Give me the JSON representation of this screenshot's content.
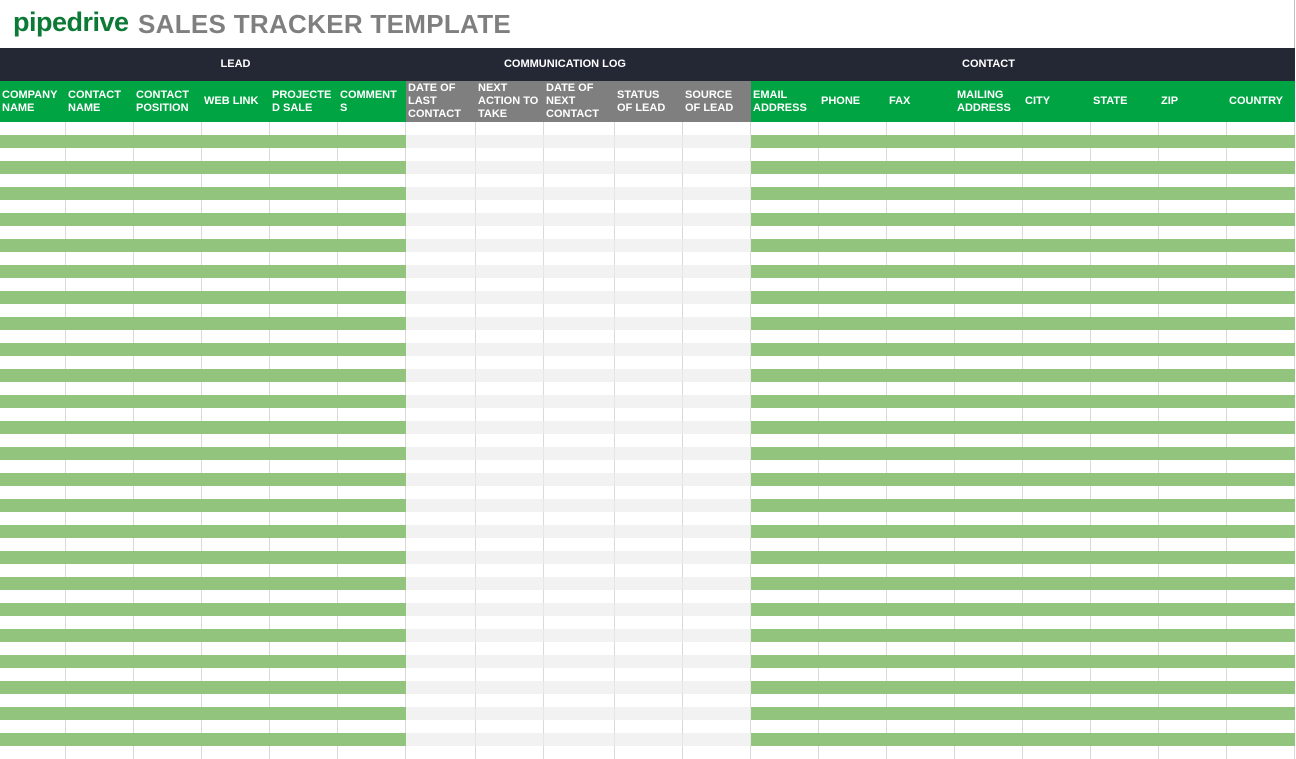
{
  "header": {
    "logo_text": "pipedrive",
    "title": "SALES TRACKER TEMPLATE"
  },
  "colors": {
    "logo_green": "#0c7a36",
    "group_bar": "#232834",
    "lead_header": "#00a443",
    "comm_header": "#7f7f7f",
    "stripe_green": "#93c47d",
    "stripe_gray": "#f2f2f2"
  },
  "groups": [
    {
      "label": "LEAD"
    },
    {
      "label": "COMMUNICATION LOG"
    },
    {
      "label": "CONTACT"
    }
  ],
  "columns": [
    {
      "label": "COMPANY\nNAME",
      "group": "lead"
    },
    {
      "label": "CONTACT\nNAME",
      "group": "lead"
    },
    {
      "label": "CONTACT\nPOSITION",
      "group": "lead"
    },
    {
      "label": "WEB LINK",
      "group": "lead"
    },
    {
      "label": "PROJECTE\nD SALE",
      "group": "lead"
    },
    {
      "label": "COMMENT\nS",
      "group": "lead"
    },
    {
      "label": "DATE OF\nLAST\nCONTACT",
      "group": "comm"
    },
    {
      "label": "NEXT\nACTION TO\nTAKE",
      "group": "comm"
    },
    {
      "label": "DATE OF\nNEXT\nCONTACT",
      "group": "comm"
    },
    {
      "label": "STATUS\nOF LEAD",
      "group": "comm"
    },
    {
      "label": "SOURCE\nOF LEAD",
      "group": "comm"
    },
    {
      "label": "EMAIL\nADDRESS",
      "group": "contact"
    },
    {
      "label": "PHONE",
      "group": "contact"
    },
    {
      "label": "FAX",
      "group": "contact"
    },
    {
      "label": "MAILING\nADDRESS",
      "group": "contact"
    },
    {
      "label": "CITY",
      "group": "contact"
    },
    {
      "label": "STATE",
      "group": "contact"
    },
    {
      "label": "ZIP",
      "group": "contact"
    },
    {
      "label": "COUNTRY",
      "group": "contact"
    }
  ],
  "empty_row_count": 49
}
